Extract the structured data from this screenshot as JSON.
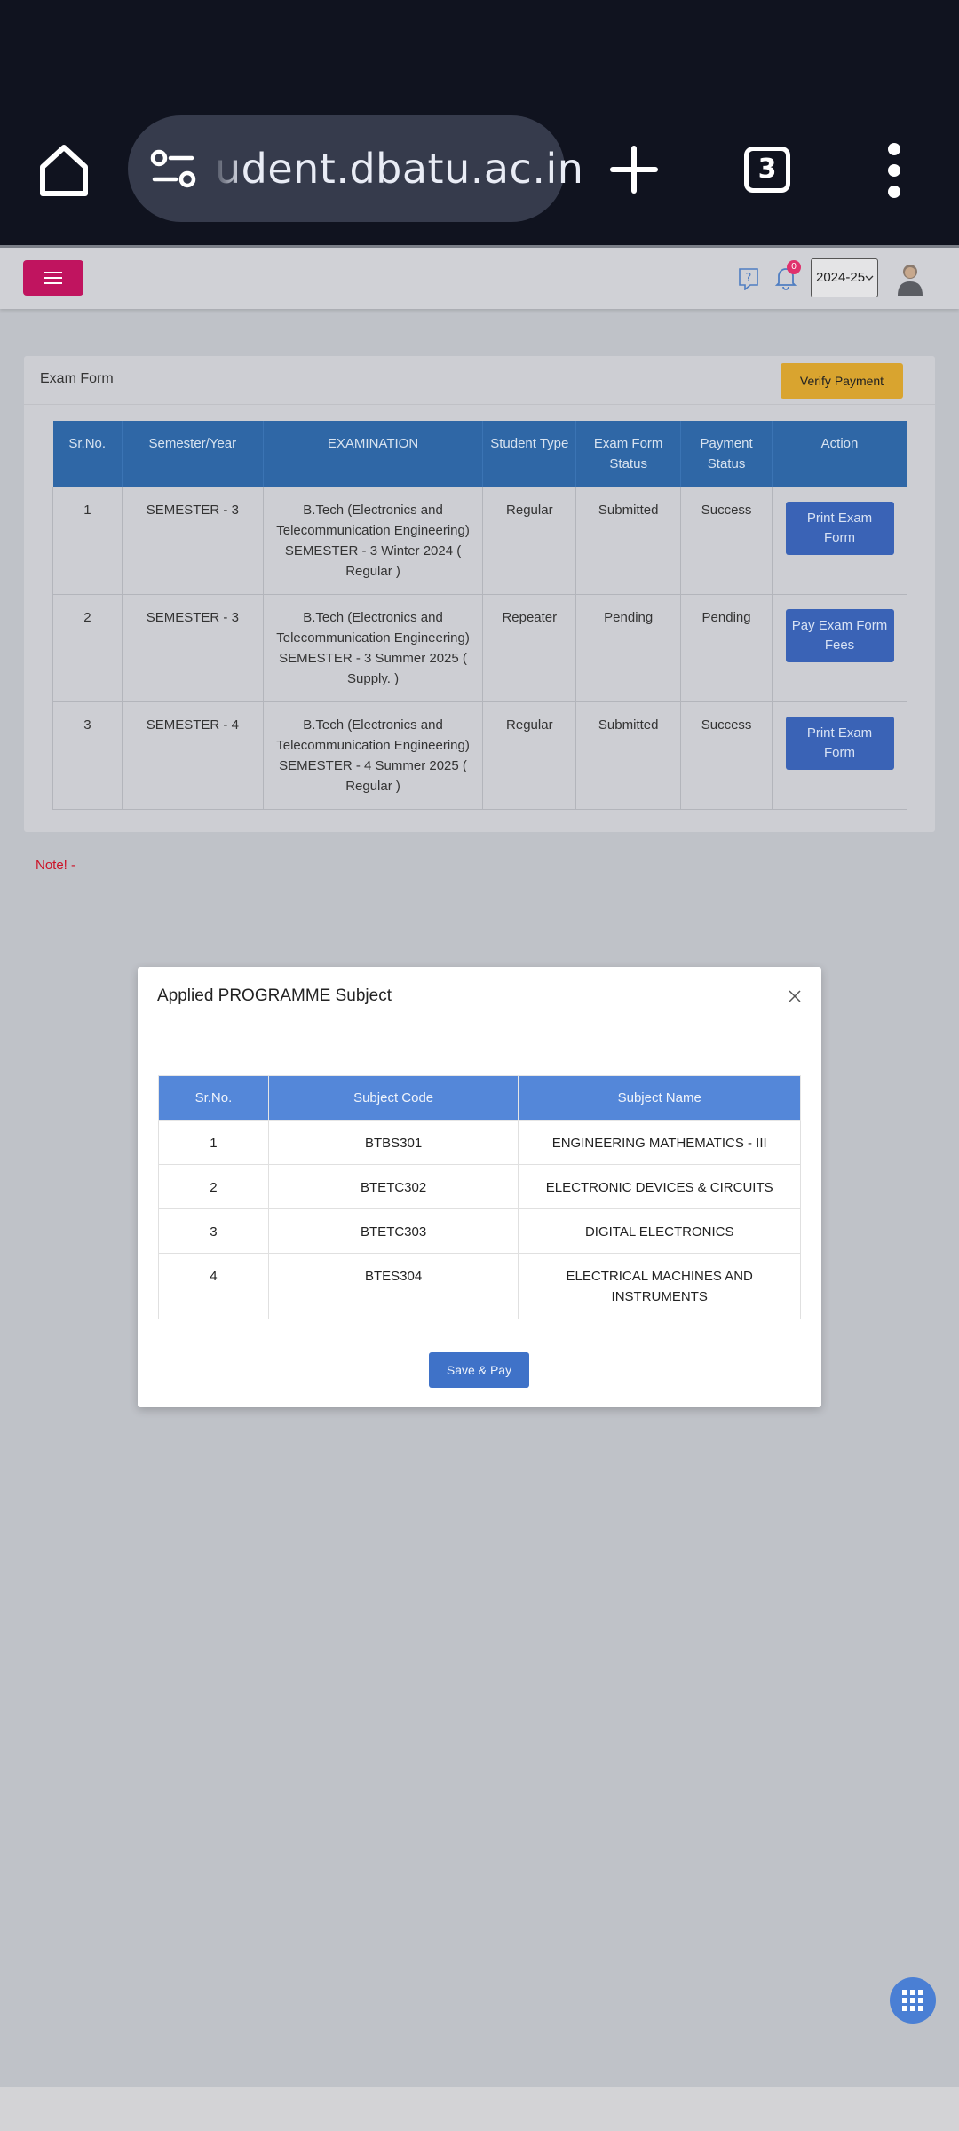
{
  "browser": {
    "url": "udent.dbatu.ac.in",
    "tab_count": "3"
  },
  "header": {
    "notification_count": "0",
    "academic_year": "2024-25"
  },
  "exam_form": {
    "title": "Exam Form",
    "verify_button": "Verify Payment",
    "columns": [
      "Sr.No.",
      "Semester/Year",
      "EXAMINATION",
      "Student Type",
      "Exam Form Status",
      "Payment Status",
      "Action"
    ],
    "rows": [
      {
        "sr": "1",
        "semester": "SEMESTER - 3",
        "examination": "B.Tech (Electronics and Telecommunication Engineering) SEMESTER - 3 Winter 2024 ( Regular )",
        "student_type": "Regular",
        "form_status": "Submitted",
        "payment_status": "Success",
        "action": "Print Exam Form"
      },
      {
        "sr": "2",
        "semester": "SEMESTER - 3",
        "examination": "B.Tech (Electronics and Telecommunication Engineering) SEMESTER - 3 Summer 2025 ( Supply. )",
        "student_type": "Repeater",
        "form_status": "Pending",
        "payment_status": "Pending",
        "action": "Pay Exam Form Fees"
      },
      {
        "sr": "3",
        "semester": "SEMESTER - 4",
        "examination": "B.Tech (Electronics and Telecommunication Engineering) SEMESTER - 4 Summer 2025 ( Regular )",
        "student_type": "Regular",
        "form_status": "Submitted",
        "payment_status": "Success",
        "action": "Print Exam Form"
      }
    ]
  },
  "note": "Note! -",
  "modal": {
    "title": "Applied PROGRAMME Subject",
    "columns": [
      "Sr.No.",
      "Subject Code",
      "Subject Name"
    ],
    "rows": [
      {
        "sr": "1",
        "code": "BTBS301",
        "name": "ENGINEERING MATHEMATICS - III"
      },
      {
        "sr": "2",
        "code": "BTETC302",
        "name": "ELECTRONIC DEVICES & CIRCUITS"
      },
      {
        "sr": "3",
        "code": "BTETC303",
        "name": "DIGITAL ELECTRONICS"
      },
      {
        "sr": "4",
        "code": "BTES304",
        "name": "ELECTRICAL MACHINES AND INSTRUMENTS"
      }
    ],
    "save_button": "Save & Pay"
  },
  "colors": {
    "menu_button": "#c0145f",
    "verify_button": "#d9a42f",
    "table_header": "#2f67a6",
    "action_button": "#3a63b6",
    "modal_header": "#5487d9",
    "note_text": "#cc1328"
  }
}
